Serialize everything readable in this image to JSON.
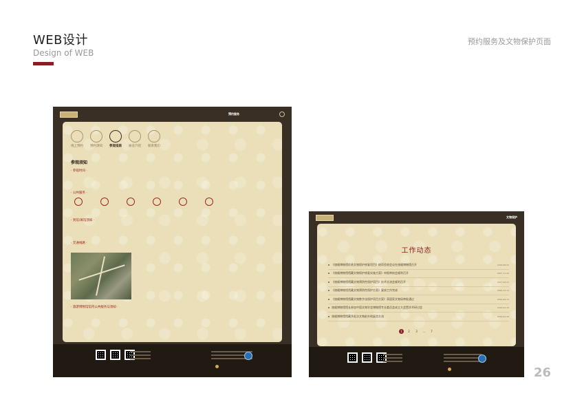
{
  "slide": {
    "title": "WEB设计",
    "subtitle": "Design of WEB",
    "section_label": "预约服务及文物保护页面",
    "page_number": "26",
    "accent_color": "#8b1e1e"
  },
  "nav": {
    "active_left": "预约服务",
    "active_right": "文物保护"
  },
  "left_page": {
    "tabs": [
      {
        "label": "线上预约"
      },
      {
        "label": "预约须知"
      },
      {
        "label": "参观指南",
        "active": true
      },
      {
        "label": "展览介绍"
      },
      {
        "label": "联系我们"
      }
    ],
    "section_title": "参观须知",
    "visit_time_heading": "· 参观时间 ·",
    "public_service_heading": "· 公共服务 ·",
    "notice_heading": "· 到馆/离馆须知 ·",
    "traffic_heading": "· 交通线路 ·",
    "bottom_heading": "· 旅游博物馆馆内公共服务与须知 ·",
    "services": [
      {
        "icon": "service-icon"
      },
      {
        "icon": "service-icon"
      },
      {
        "icon": "service-icon"
      },
      {
        "icon": "service-icon"
      },
      {
        "icon": "service-icon"
      },
      {
        "icon": "service-icon"
      }
    ]
  },
  "right_page": {
    "title": "工作动态",
    "news": [
      {
        "title": "《旅顺博物馆珍贵文物保护修复项目》结项验收会议在旅顺博物馆召开",
        "date": "2018.08.03"
      },
      {
        "title": "《旅顺博物馆馆藏文物保护修复实施方案》申报审核会顺利召开",
        "date": "2017.11.20"
      },
      {
        "title": "《旅顺博物馆馆藏文物预防性保护项目》技术交流会顺利召开",
        "date": "2017.06.23"
      },
      {
        "title": "《旅顺博物馆馆藏文物预防性保护方案》复核工作完成",
        "date": "2016.12.14"
      },
      {
        "title": "《旅顺博物馆馆藏文物数字化保护项目方案》获国家文物局审批通过",
        "date": "2016.09.13"
      },
      {
        "title": "旅顺博物馆馆长参加中国文物学会博物馆专业委员会成立大会暨学术研讨会",
        "date": "2016.04.15"
      },
      {
        "title": "旅顺博物馆馆藏多批次文物赴外地展览交流",
        "date": "2016.02.26"
      }
    ],
    "pages": [
      "1",
      "2",
      "3",
      "...",
      "7"
    ]
  }
}
